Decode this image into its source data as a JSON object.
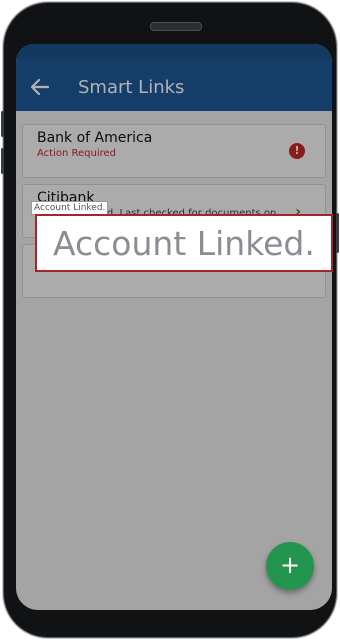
{
  "app": {
    "title": "Smart Links"
  },
  "cards": [
    {
      "name": "Bank of America",
      "status": "Action Required"
    },
    {
      "name": "Citibank",
      "status": "Account Linked. Last checked for documents on"
    },
    {
      "name": "",
      "status": ""
    }
  ],
  "tooltip": {
    "small": "Account Linked.",
    "large": "Account Linked."
  },
  "fab": {
    "label": "+"
  },
  "colors": {
    "appbar": "#1e5a97",
    "fab": "#23954f",
    "alert": "#c62828",
    "link_ok": "#2e7d32"
  }
}
